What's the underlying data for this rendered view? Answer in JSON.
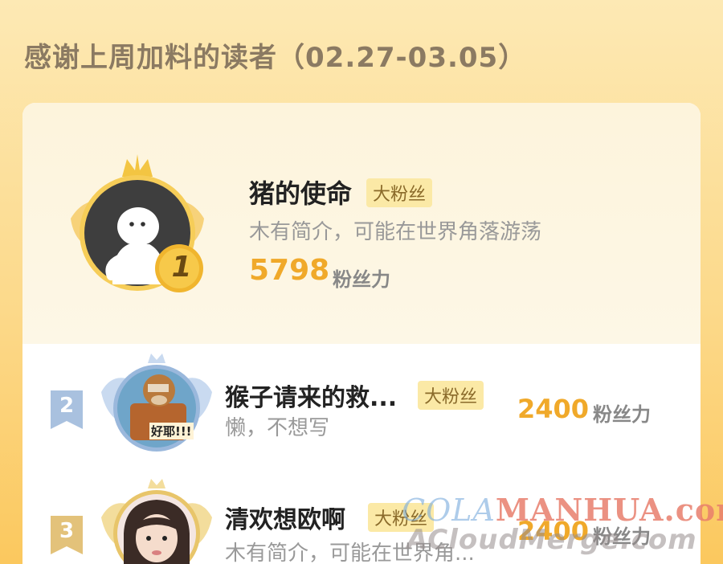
{
  "header": {
    "title": "感谢上周加料的读者（02.27-03.05）"
  },
  "top_fan": {
    "rank": "1",
    "name": "猪的使命",
    "tag": "大粉丝",
    "description": "木有简介，可能在世界角落游荡",
    "score": "5798",
    "score_unit": "粉丝力"
  },
  "list": [
    {
      "rank": "2",
      "name": "猴子请来的救...",
      "tag": "大粉丝",
      "description": "懒，不想写",
      "score": "2400",
      "score_unit": "粉丝力",
      "avatar_caption": "好耶!!!"
    },
    {
      "rank": "3",
      "name": "清欢想欧啊",
      "tag": "大粉丝",
      "description": "木有简介，可能在世界角...",
      "score": "2400",
      "score_unit": "粉丝力"
    }
  ],
  "watermark": {
    "line1_prefix": "COLA",
    "line1_suffix": "MANHUA.com",
    "line2": "ACloudMerge.com"
  },
  "colors": {
    "accent": "#f0a92a",
    "background_top": "#fde9b4",
    "background_bottom": "#fbc85e",
    "tag_bg": "#fbe9a6"
  }
}
